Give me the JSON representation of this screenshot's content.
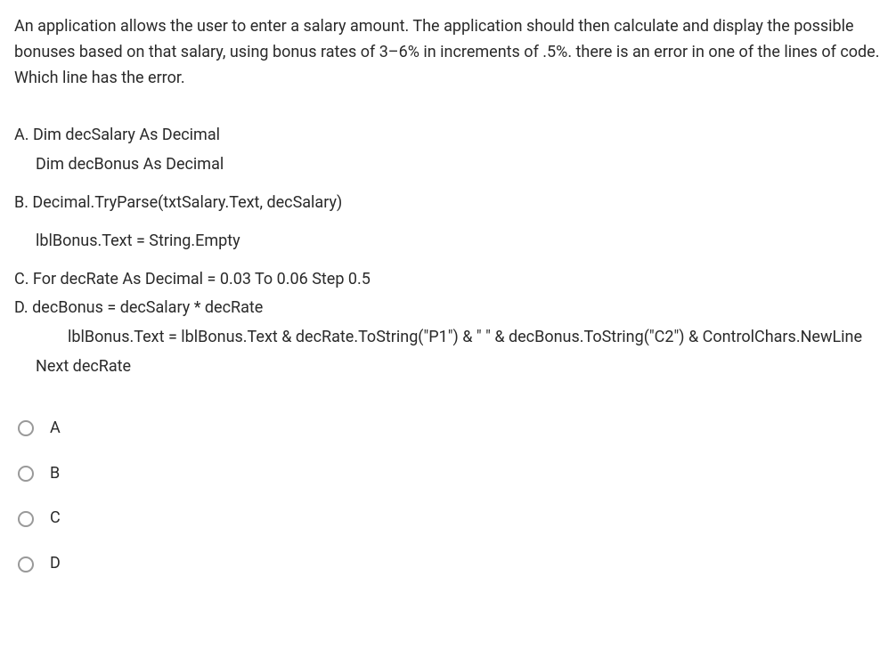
{
  "question": "An application allows the user to enter a salary amount. The application should then calculate and display the possible bonuses based on that salary, using bonus rates of 3–6% in increments of .5%.  there is an error in one of the lines of code.  Which line has the error.",
  "code": {
    "lineA1": "A. Dim decSalary As Decimal",
    "lineA2": "Dim decBonus As Decimal",
    "lineB1": "B. Decimal.TryParse(txtSalary.Text, decSalary)",
    "lineB2": "lblBonus.Text = String.Empty",
    "lineC1": "C. For decRate As Decimal = 0.03 To 0.06 Step 0.5",
    "lineD1": "D.      decBonus = decSalary * decRate",
    "lineD2": "lblBonus.Text = lblBonus.Text & decRate.ToString(\"P1\") & \"    \" & decBonus.ToString(\"C2\") & ControlChars.NewLine",
    "lineD3": "Next decRate"
  },
  "options": {
    "a": "A",
    "b": "B",
    "c": "C",
    "d": "D"
  }
}
